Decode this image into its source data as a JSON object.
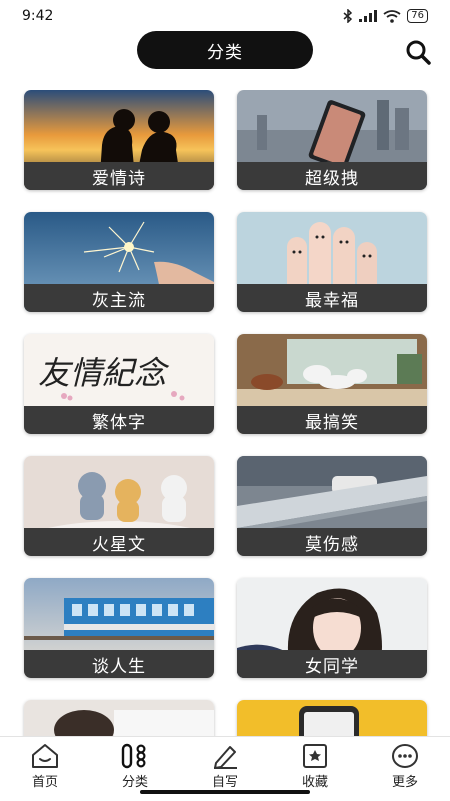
{
  "status": {
    "time": "9:42",
    "battery": "76"
  },
  "header": {
    "title": "分类"
  },
  "categories": [
    {
      "label": "爱情诗"
    },
    {
      "label": "超级拽"
    },
    {
      "label": "灰主流"
    },
    {
      "label": "最幸福"
    },
    {
      "label": "繁体字"
    },
    {
      "label": "最搞笑"
    },
    {
      "label": "火星文"
    },
    {
      "label": "莫伤感"
    },
    {
      "label": "谈人生"
    },
    {
      "label": "女同学"
    }
  ],
  "art": {
    "calligraphy": "友情紀念"
  },
  "tabs": [
    {
      "label": "首页"
    },
    {
      "label": "分类"
    },
    {
      "label": "自写"
    },
    {
      "label": "收藏"
    },
    {
      "label": "更多"
    }
  ],
  "colors": {
    "accent": "#111111",
    "label_bar": "#3a3a3a",
    "background": "#ffffff"
  }
}
